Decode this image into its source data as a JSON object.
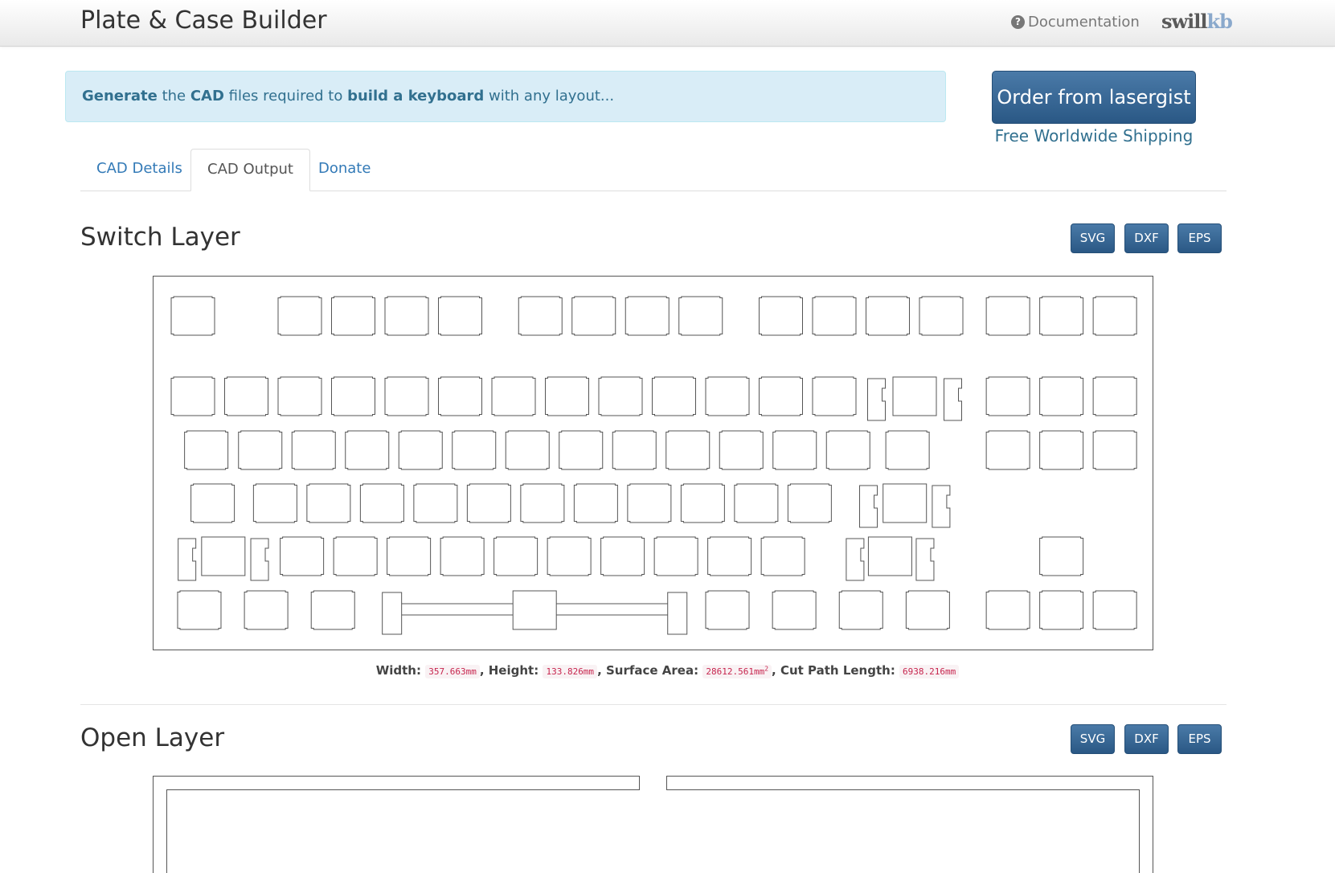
{
  "navbar": {
    "brand": "Plate & Case Builder",
    "documentation": "Documentation",
    "logo_a": "swill",
    "logo_b": "kb"
  },
  "alert": {
    "w1": "Generate",
    "w2": " the ",
    "w3": "CAD",
    "w4": " files required to ",
    "w5": "build a keyboard",
    "w6": " with any layout..."
  },
  "order": {
    "button": "Order from lasergist",
    "shipping": "Free Worldwide Shipping"
  },
  "tabs": [
    {
      "label": "CAD Details",
      "active": false
    },
    {
      "label": "CAD Output",
      "active": true
    },
    {
      "label": "Donate",
      "active": false
    }
  ],
  "switch_layer": {
    "title": "Switch Layer",
    "buttons": [
      "SVG",
      "DXF",
      "EPS"
    ],
    "stats": {
      "width_label": "Width:",
      "width": "357.663mm",
      "height_label": "Height:",
      "height": "133.826mm",
      "area_label": "Surface Area:",
      "area": "28612.561mm",
      "area_sup": "2",
      "cut_label": "Cut Path Length:",
      "cut": "6938.216mm"
    }
  },
  "open_layer": {
    "title": "Open Layer",
    "buttons": [
      "SVG",
      "DXF",
      "EPS"
    ]
  },
  "colors": {
    "accent": "#2a5885",
    "alert_bg": "#d9edf7",
    "link": "#337ab7"
  }
}
